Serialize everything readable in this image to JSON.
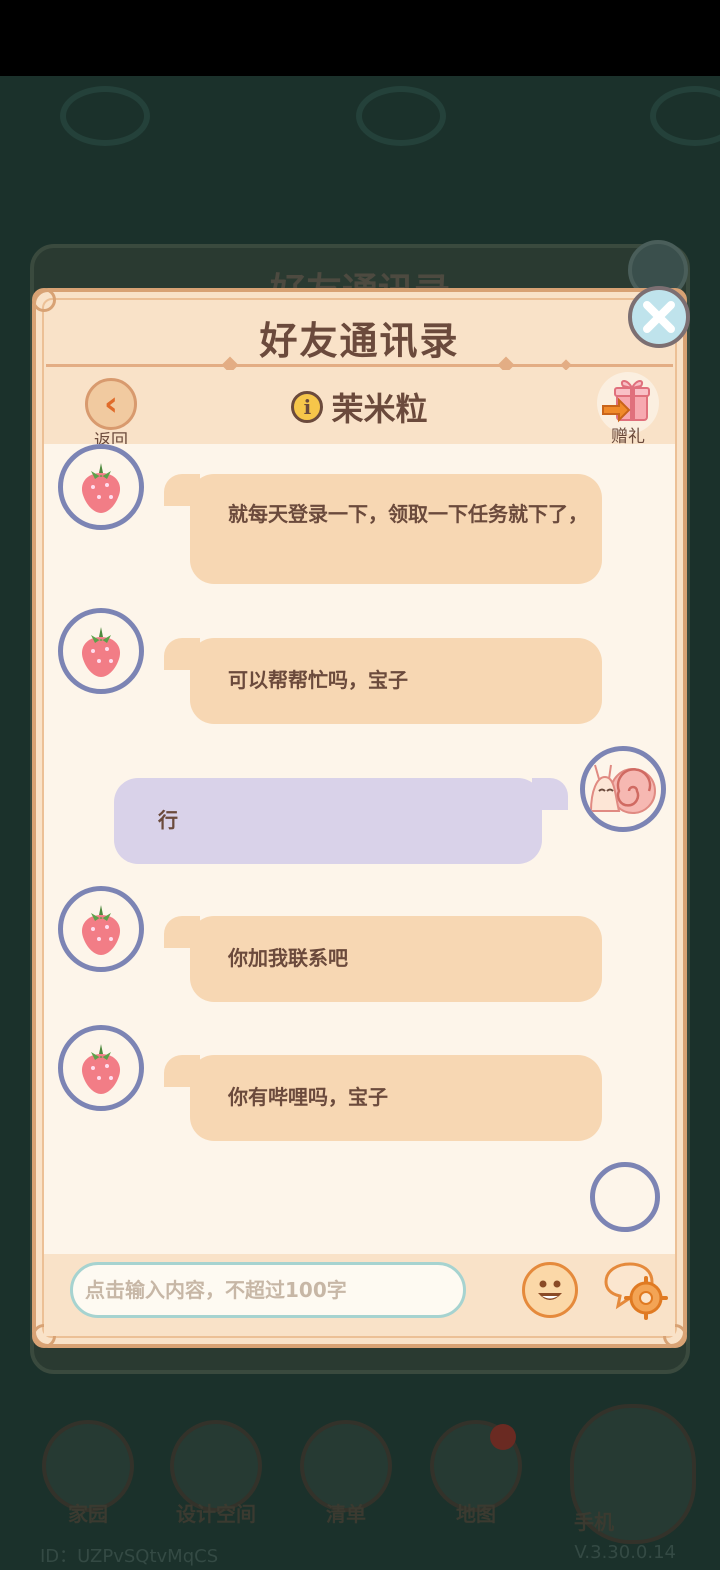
{
  "background": {
    "back_title": "好友通讯录",
    "nav": [
      {
        "label": "家园"
      },
      {
        "label": "设计空间"
      },
      {
        "label": "清单"
      },
      {
        "label": "地图"
      },
      {
        "label": "手机"
      }
    ],
    "user_id": "ID：UZPvSQtvMqCS",
    "version": "V.3.30.0.14"
  },
  "dialog": {
    "title": "好友通讯录",
    "back_label": "返回",
    "contact_name": "茉米粒",
    "gift_label": "赠礼",
    "info_icon": "i"
  },
  "messages": [
    {
      "side": "left",
      "avatar": "strawberry-icon",
      "text": "就每天登录一下，领取一下任务就下了，"
    },
    {
      "side": "left",
      "avatar": "strawberry-icon",
      "text": "可以帮帮忙吗，宝子"
    },
    {
      "side": "right",
      "avatar": "snail-icon",
      "text": "行"
    },
    {
      "side": "left",
      "avatar": "strawberry-icon",
      "text": "你加我联系吧"
    },
    {
      "side": "left",
      "avatar": "strawberry-icon",
      "text": "你有哔哩吗，宝子"
    }
  ],
  "input": {
    "placeholder": "点击输入内容，不超过100字"
  },
  "colors": {
    "panel": "#f9e2c8",
    "chat_bg": "#fdf5ea",
    "bubble_left": "#f7d7b3",
    "bubble_right": "#d9d2e9",
    "text": "#6b4a3c",
    "avatar_ring": "#7c84b4"
  }
}
